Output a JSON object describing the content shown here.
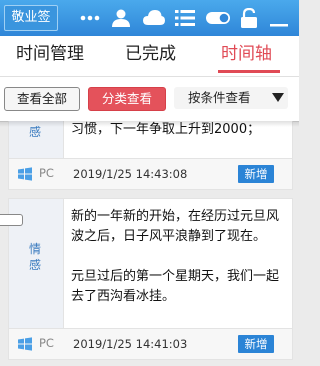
{
  "app": {
    "title": "敬业签",
    "accent": "#2f86d8"
  },
  "toolbar": {
    "icons": [
      "more-icon",
      "user-icon",
      "cloud-icon",
      "list-icon",
      "toggle-icon",
      "lock-icon",
      "minimize-icon"
    ]
  },
  "tabs": [
    {
      "label": "时间管理",
      "active": false
    },
    {
      "label": "已完成",
      "active": false
    },
    {
      "label": "时间轴",
      "active": true
    }
  ],
  "filters": {
    "view_all": "查看全部",
    "by_category": "分类查看",
    "by_condition": "按条件查看"
  },
  "timeline": {
    "items": [
      {
        "category": "感",
        "text": "习惯，下一年争取上升到2000；",
        "os": "PC",
        "time": "2019/1/25 14:43:08",
        "badge": "新增"
      },
      {
        "category": "情感",
        "text": "新的一年新的开始，在经历过元旦风波之后，日子风平浪静到了现在。\n\n元旦过后的第一个星期天，我们一起去了西沟看冰挂。",
        "os": "PC",
        "time": "2019/1/25 14:41:03",
        "badge": "新增"
      }
    ]
  }
}
